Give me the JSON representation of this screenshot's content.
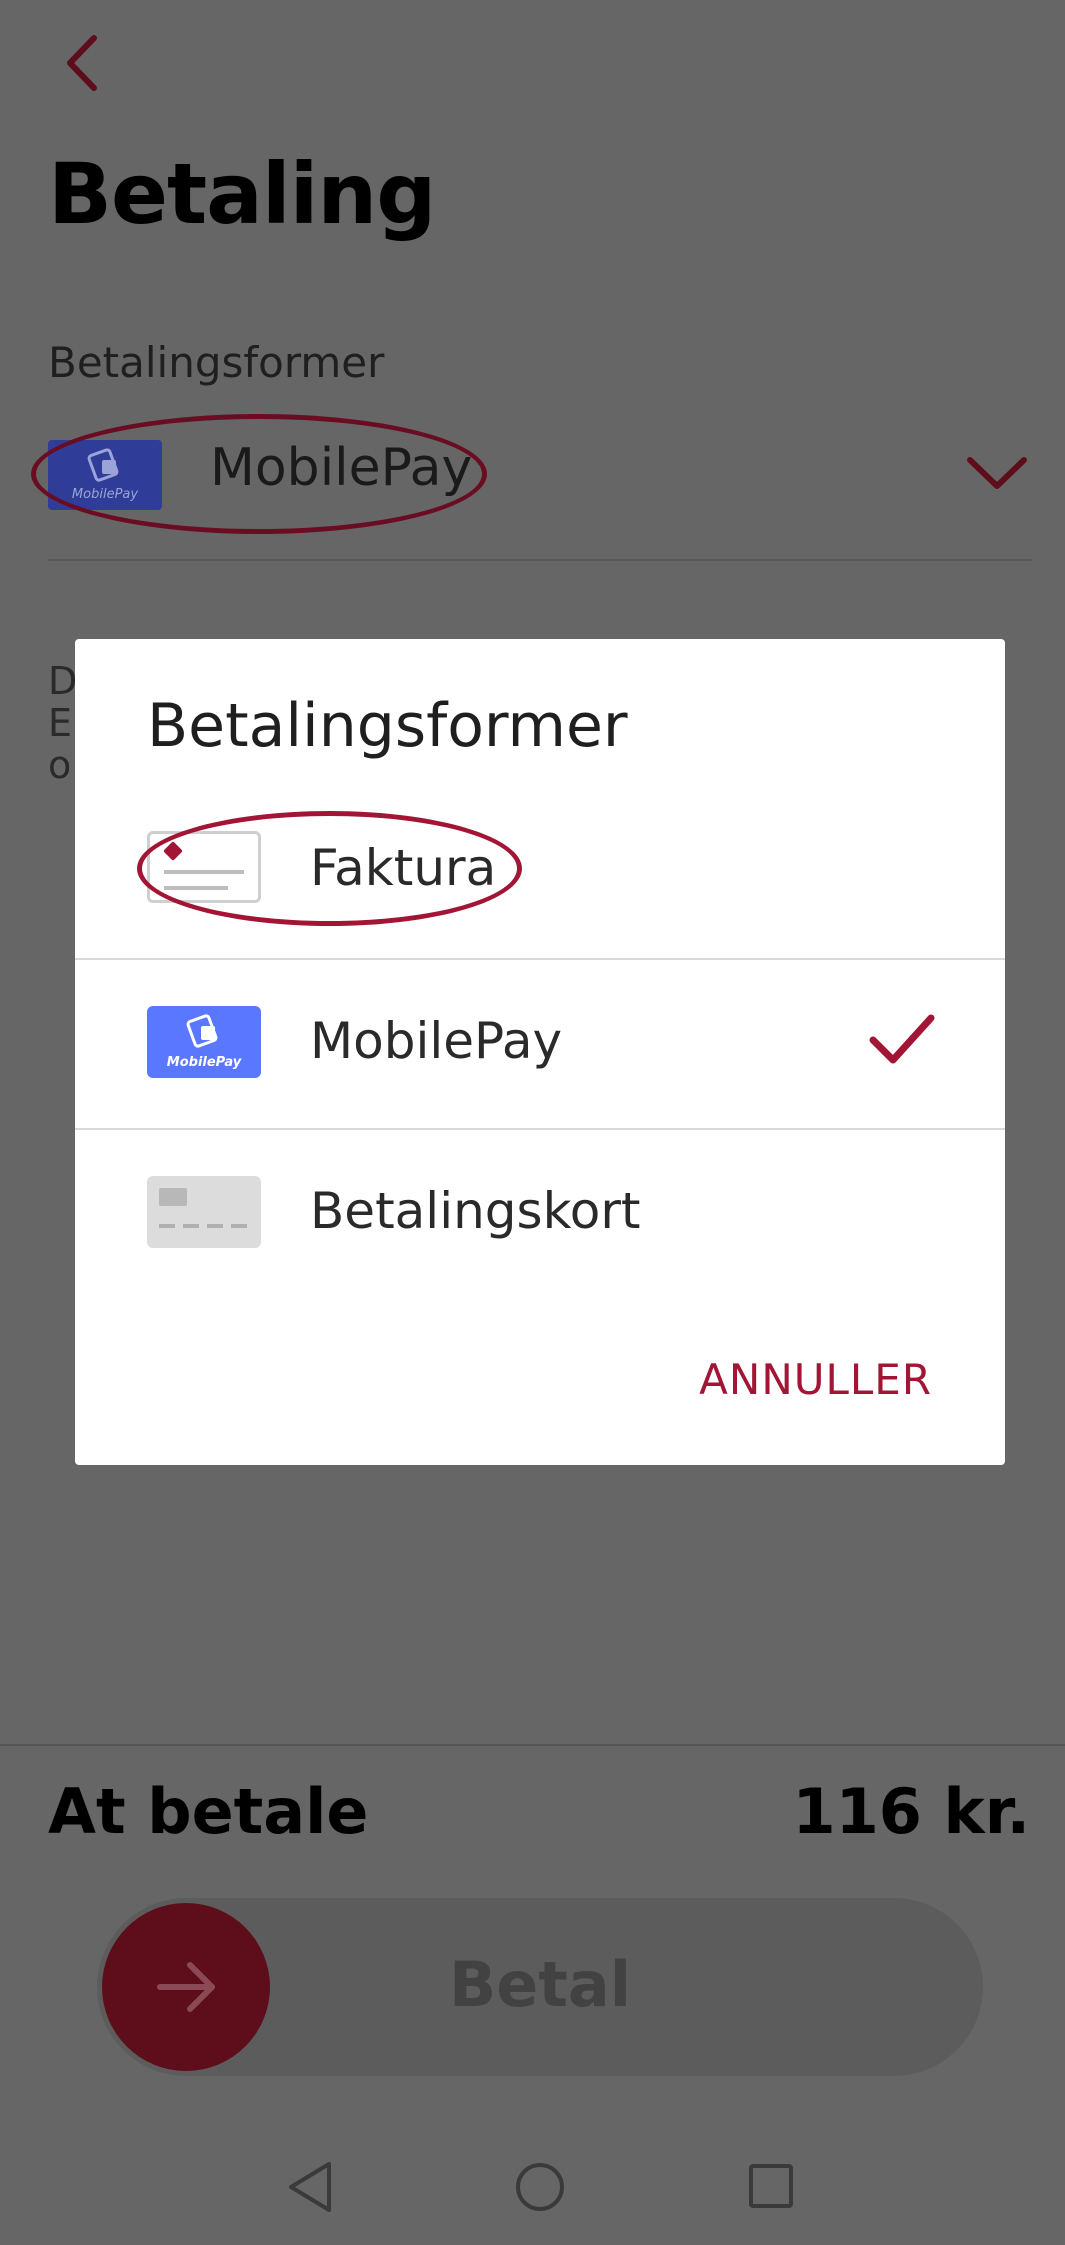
{
  "header": {
    "page_title": "Betaling",
    "back_icon": "chevron-left-icon"
  },
  "payment": {
    "section_label": "Betalingsformer",
    "selected_method": "MobilePay",
    "partial_text_lines": [
      "D",
      "E",
      "o"
    ]
  },
  "summary": {
    "total_label": "At betale",
    "total_value": "116 kr."
  },
  "pay_button": {
    "label": "Betal",
    "icon": "arrow-right-icon"
  },
  "dialog": {
    "title": "Betalingsformer",
    "options": [
      {
        "label": "Faktura",
        "icon": "invoice-icon",
        "selected": false
      },
      {
        "label": "MobilePay",
        "icon": "mobilepay-logo-icon",
        "logo_text": "MobilePay",
        "selected": true
      },
      {
        "label": "Betalingskort",
        "icon": "payment-card-icon",
        "selected": false
      }
    ],
    "cancel_label": "ANNULLER"
  },
  "colors": {
    "accent": "#a31535",
    "scrim": "#666666",
    "mobilepay_blue": "#5a78ff"
  }
}
